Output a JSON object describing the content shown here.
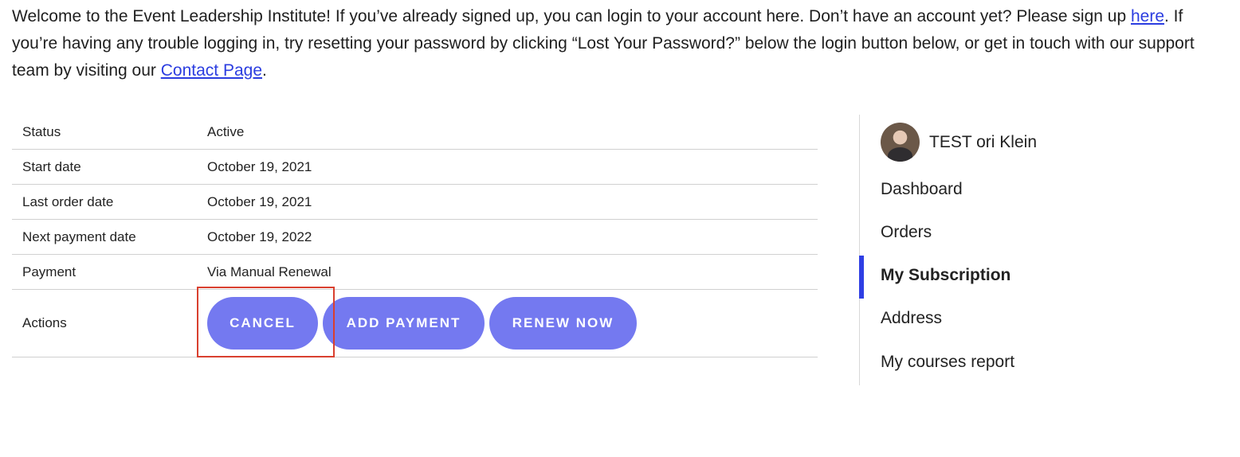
{
  "intro": {
    "text_before_here": "Welcome to the Event Leadership Institute! If you’ve already signed up, you can login to your account here. Don’t have an account yet? Please sign up ",
    "here_link": "here",
    "text_after_here": ". If you’re having any trouble logging in, try resetting your password by clicking “Lost Your Password?” below the login button below, or get in touch with our support team by visiting our ",
    "contact_link": "Contact Page",
    "text_end": "."
  },
  "subscription": {
    "rows": [
      {
        "label": "Status",
        "value": "Active"
      },
      {
        "label": "Start date",
        "value": "October 19, 2021"
      },
      {
        "label": "Last order date",
        "value": "October 19, 2021"
      },
      {
        "label": "Next payment date",
        "value": "October 19, 2022"
      },
      {
        "label": "Payment",
        "value": "Via Manual Renewal"
      }
    ],
    "actions_label": "Actions",
    "buttons": {
      "cancel": "CANCEL",
      "add_payment": "ADD PAYMENT",
      "renew_now": "RENEW NOW"
    }
  },
  "sidebar": {
    "user_name": "TEST ori Klein",
    "nav": [
      {
        "label": "Dashboard",
        "active": false
      },
      {
        "label": "Orders",
        "active": false
      },
      {
        "label": "My Subscription",
        "active": true
      },
      {
        "label": "Address",
        "active": false
      },
      {
        "label": "My courses report",
        "active": false
      }
    ]
  },
  "colors": {
    "button_bg": "#7479f0",
    "link": "#2b3de0",
    "active_indicator": "#2f3fe4",
    "highlight": "#d9402f"
  }
}
